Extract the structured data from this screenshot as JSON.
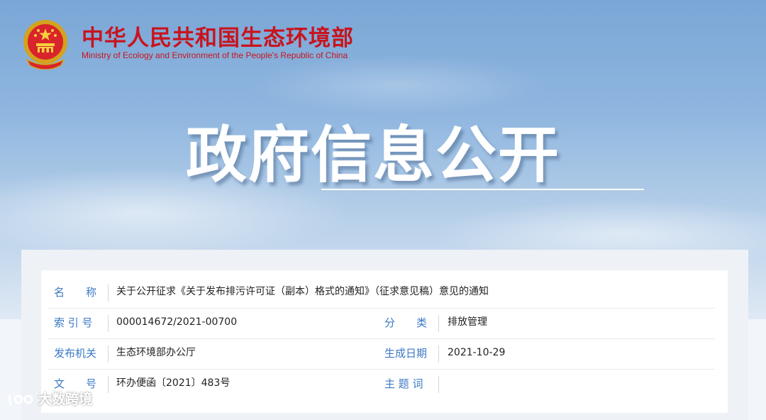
{
  "header": {
    "site_title": "中华人民共和国生态环境部",
    "site_subtitle": "Ministry of Ecology and Environment of the People's Republic of China",
    "emblem_icon": "national-emblem-icon",
    "headline": "政府信息公开",
    "accent_color": "#c8141e"
  },
  "info": {
    "name": {
      "label": "名　　称",
      "value": "关于公开征求《关于发布排污许可证（副本）格式的通知》（征求意见稿）意见的通知"
    },
    "index_no": {
      "label": "索 引 号",
      "value": "000014672/2021-00700"
    },
    "category": {
      "label": "分　　类",
      "value": "排放管理"
    },
    "publisher": {
      "label": "发布机关",
      "value": "生态环境部办公厅"
    },
    "date": {
      "label": "生成日期",
      "value": "2021-10-29"
    },
    "doc_no": {
      "label": "文　　号",
      "value": "环办便函〔2021〕483号"
    },
    "keywords": {
      "label": "主 题 词",
      "value": ""
    },
    "label_color": "#3b78c4"
  },
  "watermark": {
    "text": "大数跨境",
    "icon": "watermark-logo-icon"
  }
}
